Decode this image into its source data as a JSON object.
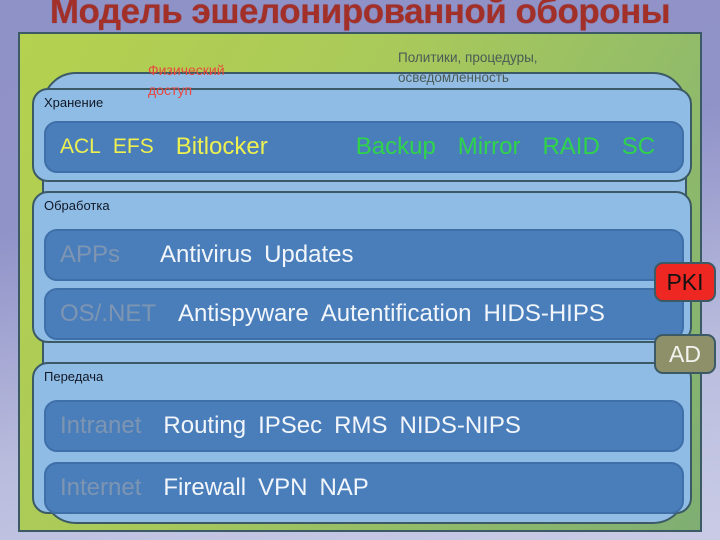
{
  "slide": {
    "title": "Модель эшелонированной обороны",
    "title_color": "#a33028"
  },
  "annotations": {
    "physical_access": "Физический доступ",
    "physical_access_color": "#e8483f",
    "policies": "Политики, процедуры, осведомленность",
    "policies_color": "#4b5b56"
  },
  "groups": [
    {
      "label": "Хранение",
      "rows": [
        {
          "lead": "",
          "items": [
            {
              "text": "ACL",
              "color": "#edf04f"
            },
            {
              "text": "EFS",
              "color": "#edf04f"
            },
            {
              "text": "Bitlocker",
              "color": "#edf04f"
            },
            {
              "text": "Backup",
              "color": "#2fd44a"
            },
            {
              "text": "Mirror",
              "color": "#2fd44a"
            },
            {
              "text": "RAID",
              "color": "#2fd44a"
            },
            {
              "text": "SC",
              "color": "#2fd44a"
            }
          ]
        }
      ]
    },
    {
      "label": "Обработка",
      "rows": [
        {
          "lead": "APPs",
          "items": [
            {
              "text": "Antivirus",
              "color": "#f2f6fb"
            },
            {
              "text": "Updates",
              "color": "#f2f6fb"
            }
          ]
        },
        {
          "lead": "OS/.NET",
          "items": [
            {
              "text": "Antispyware",
              "color": "#f2f6fb"
            },
            {
              "text": "Autentification",
              "color": "#f2f6fb"
            },
            {
              "text": "HIDS-HIPS",
              "color": "#f2f6fb"
            }
          ]
        }
      ]
    },
    {
      "label": "Передача",
      "rows": [
        {
          "lead": "Intranet",
          "items": [
            {
              "text": "Routing",
              "color": "#f2f6fb"
            },
            {
              "text": "IPSec",
              "color": "#f2f6fb"
            },
            {
              "text": "RMS",
              "color": "#f2f6fb"
            },
            {
              "text": "NIDS-NIPS",
              "color": "#f2f6fb"
            }
          ]
        },
        {
          "lead": "Internet",
          "items": [
            {
              "text": "Firewall",
              "color": "#f2f6fb"
            },
            {
              "text": "VPN",
              "color": "#f2f6fb"
            },
            {
              "text": "NAP",
              "color": "#f2f6fb"
            }
          ]
        }
      ]
    }
  ],
  "side_badges": [
    {
      "label": "PKI",
      "background": "#ee2722",
      "text_color": "#131313"
    },
    {
      "label": "AD",
      "background": "#8d9069",
      "text_color": "#f3f4ef"
    }
  ]
}
